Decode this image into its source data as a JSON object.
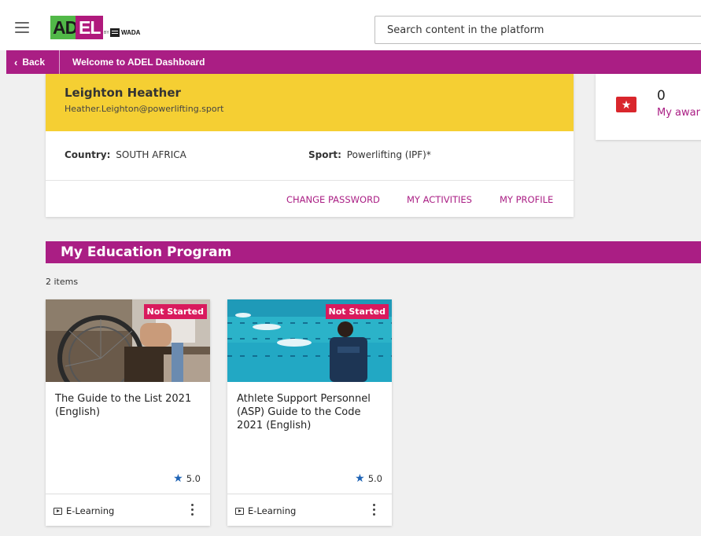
{
  "header": {
    "logo": {
      "ad": "AD",
      "el": "EL",
      "by": "BY",
      "wada": "WADA"
    },
    "search_placeholder": "Search content in the platform"
  },
  "nav": {
    "back_label": "Back",
    "title": "Welcome to ADEL Dashboard"
  },
  "profile": {
    "name": "Leighton Heather",
    "email": "Heather.Leighton@powerlifting.sport",
    "country_label": "Country:",
    "country_value": "SOUTH AFRICA",
    "sport_label": "Sport:",
    "sport_value": "Powerlifting (IPF)*",
    "links": {
      "change_password": "CHANGE PASSWORD",
      "my_activities": "MY ACTIVITIES",
      "my_profile": "MY PROFILE"
    }
  },
  "awards": {
    "count": "0",
    "label": "My awar",
    "icon": "award-ticket-icon"
  },
  "education": {
    "title": "My Education Program",
    "items_count": "2 items",
    "cards": [
      {
        "status": "Not Started",
        "title": "The Guide to the List 2021 (English)",
        "rating": "5.0",
        "type": "E-Learning"
      },
      {
        "status": "Not Started",
        "title": "Athlete Support Personnel (ASP) Guide to the Code 2021 (English)",
        "rating": "5.0",
        "type": "E-Learning"
      }
    ]
  },
  "colors": {
    "brand_purple": "#aa1e84",
    "brand_green": "#51b848",
    "profile_yellow": "#f5cf33",
    "badge_pink": "#d91a5d",
    "star_blue": "#1e63b5",
    "award_red": "#d9262c"
  }
}
